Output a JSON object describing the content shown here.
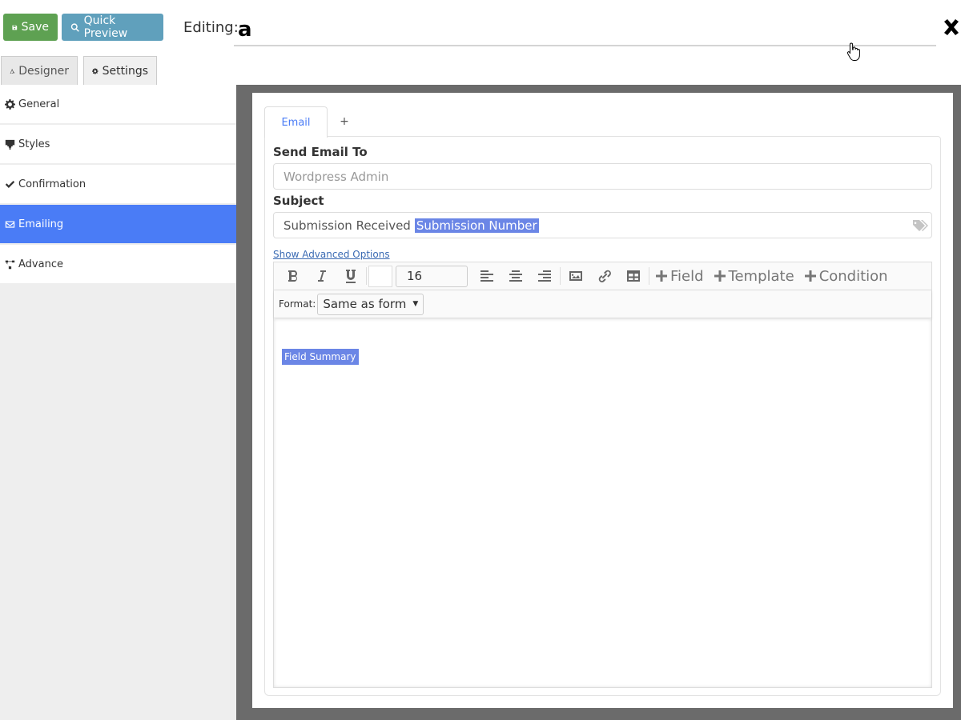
{
  "topbar": {
    "save_label": "Save",
    "preview_label": "Quick Preview",
    "editing_label": "Editing:",
    "form_title": "a",
    "colors": {
      "save": "#5ea152",
      "preview": "#60a0bc"
    }
  },
  "tabs": [
    {
      "label": "Designer",
      "icon": "compass-drafting-icon",
      "active": false
    },
    {
      "label": "Settings",
      "icon": "gear-icon",
      "active": true
    }
  ],
  "sidebar": {
    "items": [
      {
        "label": "General",
        "icon": "gear-icon",
        "active": false
      },
      {
        "label": "Styles",
        "icon": "paint-roller-icon",
        "active": false
      },
      {
        "label": "Confirmation",
        "icon": "check-icon",
        "active": false
      },
      {
        "label": "Emailing",
        "icon": "envelope-icon",
        "active": true
      },
      {
        "label": "Advance",
        "icon": "sitemap-icon",
        "active": false
      }
    ],
    "active_color": "#4a7cf6"
  },
  "email": {
    "tabs": [
      {
        "label": "Email"
      },
      {
        "label": "+"
      }
    ],
    "send_to_label": "Send Email To",
    "send_to_placeholder": "Wordpress Admin",
    "subject_label": "Subject",
    "subject_text": "Submission Received",
    "subject_token": "Submission Number",
    "advanced_link": "Show Advanced Options",
    "editor": {
      "font_size": "16",
      "insert_field": "Field",
      "insert_template": "Template",
      "insert_condition": "Condition",
      "format_label": "Format:",
      "format_value": "Same as form",
      "content_token": "Field Summary"
    }
  }
}
